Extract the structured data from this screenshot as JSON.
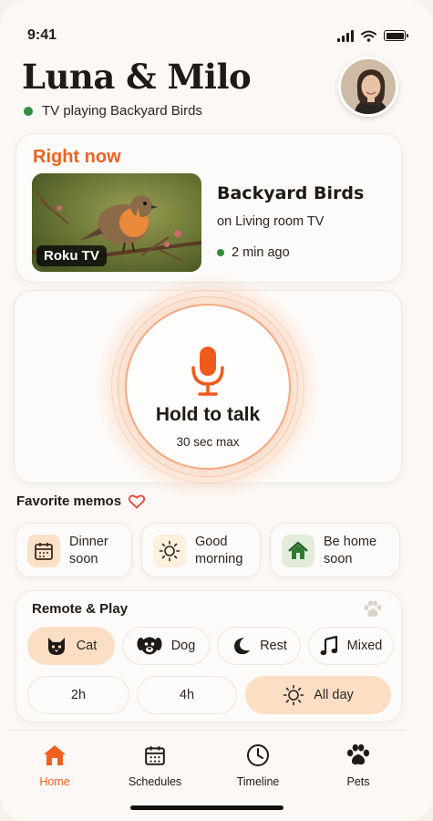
{
  "status": {
    "time": "9:41"
  },
  "header": {
    "title": "Luna & Milo",
    "subtitle": "TV playing Backyard Birds"
  },
  "now": {
    "label": "Right now",
    "badge": "Roku TV",
    "show": "Backyard Birds",
    "where": "on Living room TV",
    "ago": "2 min ago"
  },
  "talk": {
    "title": "Hold to talk",
    "sub": "30 sec max"
  },
  "favorites": {
    "title": "Favorite memos",
    "memos": [
      {
        "line1": "Dinner",
        "line2": "soon",
        "icon": "calendar-icon"
      },
      {
        "line1": "Good",
        "line2": "morning",
        "icon": "sun-icon"
      },
      {
        "line1": "Be home",
        "line2": "soon",
        "icon": "house-icon"
      }
    ]
  },
  "remote": {
    "title": "Remote & Play",
    "modes": [
      {
        "label": "Cat",
        "icon": "cat-icon",
        "active": true
      },
      {
        "label": "Dog",
        "icon": "dog-icon",
        "active": false
      },
      {
        "label": "Rest",
        "icon": "moon-icon",
        "active": false
      },
      {
        "label": "Mixed",
        "icon": "music-icon",
        "active": false
      }
    ],
    "durations": [
      {
        "label": "2h",
        "active": false
      },
      {
        "label": "4h",
        "active": false
      },
      {
        "label": "All day",
        "active": true
      }
    ]
  },
  "tabs": [
    {
      "label": "Home",
      "icon": "home-icon",
      "active": true
    },
    {
      "label": "Schedules",
      "icon": "calendar-icon",
      "active": false
    },
    {
      "label": "Timeline",
      "icon": "clock-icon",
      "active": false
    },
    {
      "label": "Pets",
      "icon": "paw-icon",
      "active": false
    }
  ],
  "colors": {
    "accent": "#f0611f",
    "live": "#2f8f3a",
    "active_pill": "#fbdfc5"
  }
}
